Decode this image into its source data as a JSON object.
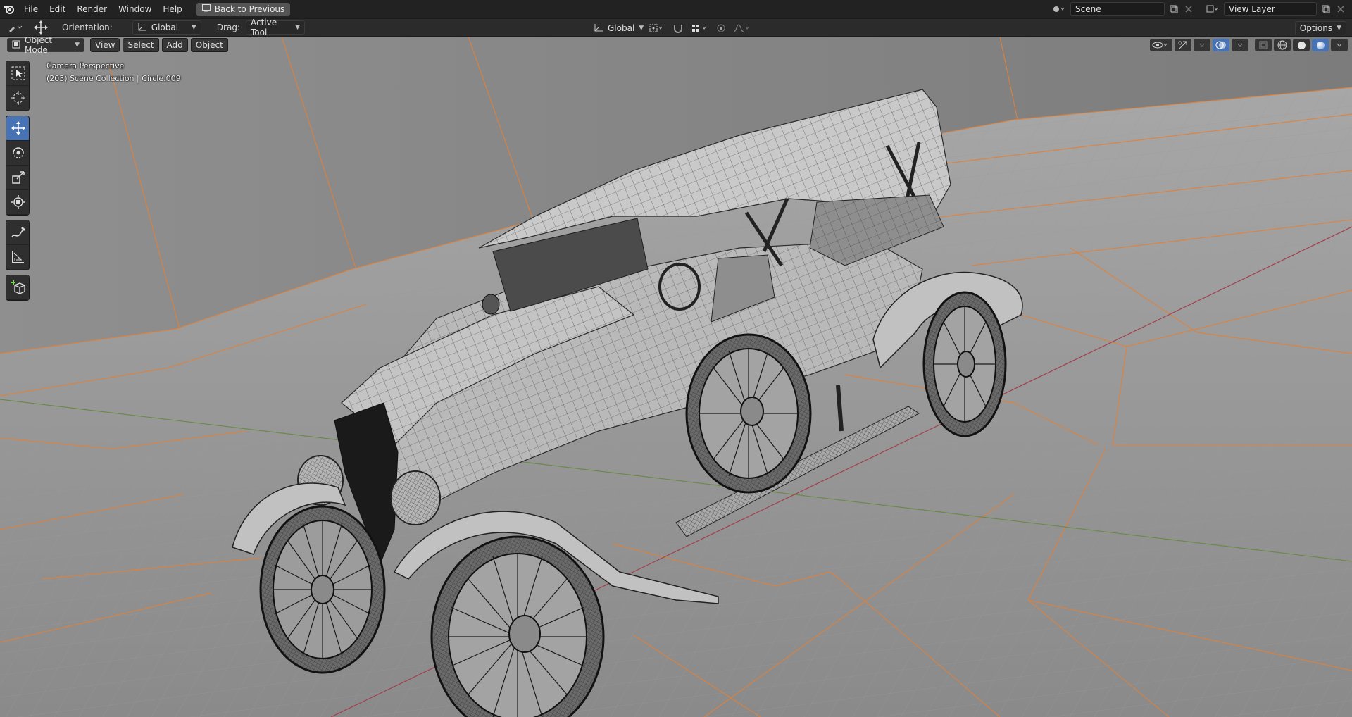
{
  "menu": {
    "items": [
      "File",
      "Edit",
      "Render",
      "Window",
      "Help"
    ],
    "back_button": "Back to Previous"
  },
  "scene": {
    "name": "Scene",
    "view_layer": "View Layer"
  },
  "tool_header": {
    "orientation_label": "Orientation:",
    "orientation_value": "Global",
    "drag_label": "Drag:",
    "drag_value": "Active Tool",
    "transform_orientation": "Global",
    "options_label": "Options"
  },
  "viewport": {
    "mode": "Object Mode",
    "header_menus": [
      "View",
      "Select",
      "Add",
      "Object"
    ],
    "overlay_title": "Camera Perspective",
    "overlay_subtitle": "(203) Scene Collection | Circle.009"
  },
  "toolbar": {
    "tools": [
      "select-box-icon",
      "cursor-icon",
      "move-icon",
      "rotate-icon",
      "scale-icon",
      "transform-icon",
      "annotate-icon",
      "measure-icon",
      "add-cube-icon"
    ],
    "active_tool": "move-icon"
  },
  "colors": {
    "accent": "#4772b3",
    "grid_orange": "#e0813a",
    "axis_red": "#a0404e",
    "axis_green": "#6a8a4a"
  }
}
